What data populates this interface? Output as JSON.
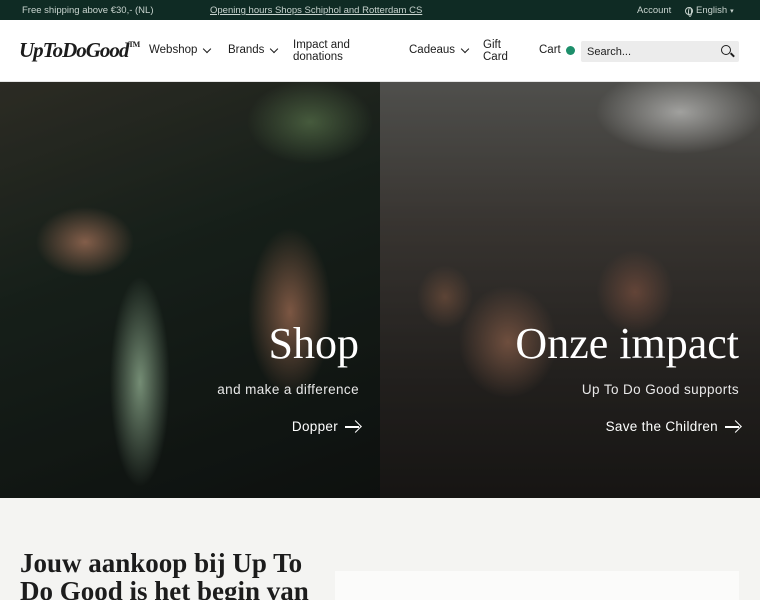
{
  "topbar": {
    "shipping": "Free shipping above €30,- (NL)",
    "hours_link": "Opening hours Shops Schiphol and Rotterdam CS",
    "account": "Account",
    "language": "English"
  },
  "header": {
    "logo": "UpToDoGood",
    "logo_tm": "TM",
    "nav": {
      "webshop": "Webshop",
      "brands": "Brands",
      "impact_line1": "Impact and",
      "impact_line2": "donations",
      "cadeaus": "Cadeaus",
      "gift_line1": "Gift",
      "gift_line2": "Card",
      "cart": "Cart"
    },
    "search_placeholder": "Search..."
  },
  "hero": {
    "left": {
      "title": "Shop",
      "subtitle": "and make a difference",
      "link": "Dopper"
    },
    "right": {
      "title": "Onze impact",
      "subtitle": "Up To Do Good supports",
      "link": "Save the Children"
    }
  },
  "intro": {
    "heading": "Jouw aankoop bij Up To Do Good is het begin van"
  },
  "colors": {
    "topbar_bg": "#0f2b24",
    "cart_badge": "#1d8f6b",
    "page_bg": "#f4f4f2"
  },
  "icons": [
    "globe-icon",
    "chevron-down-icon",
    "cart-status-dot",
    "search-icon",
    "arrow-right-icon"
  ]
}
